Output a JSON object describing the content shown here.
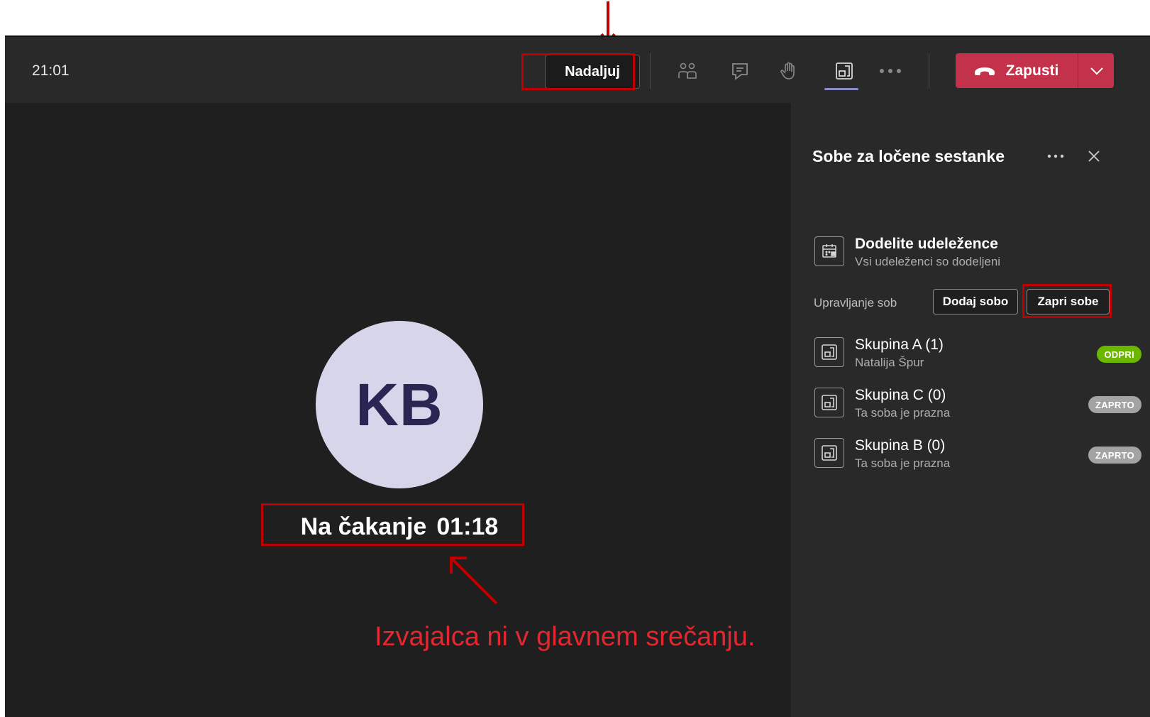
{
  "toolbar": {
    "clock": "21:01",
    "resume_label": "Nadaljuj",
    "leave_label": "Zapusti"
  },
  "stage": {
    "avatar_initials": "KB",
    "hold_label": "Na čakanje",
    "hold_timer": "01:18",
    "annotation_note": "Izvajalca ni v glavnem srečanju."
  },
  "panel": {
    "title": "Sobe za ločene sestanke",
    "assign": {
      "title": "Dodelite udeležence",
      "subtitle": "Vsi udeleženci so dodeljeni"
    },
    "manage_label": "Upravljanje sob",
    "add_room_label": "Dodaj sobo",
    "close_rooms_label": "Zapri sobe",
    "rooms": [
      {
        "name": "Skupina A (1)",
        "subtitle": "Natalija Špur",
        "status": "ODPRI"
      },
      {
        "name": "Skupina C (0)",
        "subtitle": "Ta soba je prazna",
        "status": "ZAPRTO"
      },
      {
        "name": "Skupina B (0)",
        "subtitle": "Ta soba je prazna",
        "status": "ZAPRTO"
      }
    ]
  },
  "colors": {
    "leave_button": "#c4314b",
    "badge_open": "#6bb700",
    "badge_closed": "#a3a3a3",
    "annotation": "#c00000",
    "avatar_bg": "#d6d5ea"
  },
  "icons": [
    "people-icon",
    "chat-icon",
    "raise-hand-icon",
    "breakout-rooms-icon",
    "more-icon",
    "phone-hangup-icon",
    "chevron-down-icon",
    "close-icon",
    "assign-participants-icon",
    "room-icon"
  ]
}
